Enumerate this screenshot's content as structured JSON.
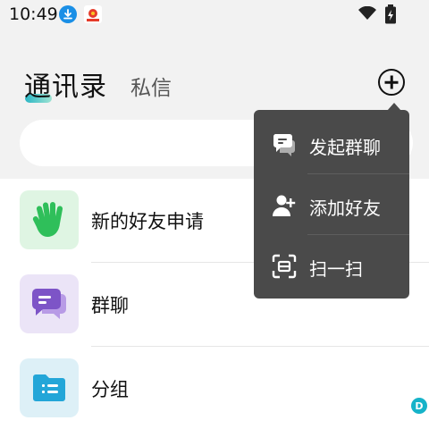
{
  "status_bar": {
    "time": "10:49",
    "icons": [
      "download-icon",
      "app-notification-icon",
      "wifi-icon",
      "battery-charging-icon"
    ]
  },
  "header": {
    "tabs": [
      {
        "label": "通讯录",
        "active": true
      },
      {
        "label": "私信",
        "active": false
      }
    ],
    "add_icon": "add-circle-icon"
  },
  "search": {
    "placeholder": ""
  },
  "contacts": {
    "items": [
      {
        "label": "新的好友申请",
        "icon": "waving-hand-icon",
        "tile_color": "#dff5e3",
        "icon_color": "#2fbf5a"
      },
      {
        "label": "群聊",
        "icon": "chat-bubbles-icon",
        "tile_color": "#ebe4f7",
        "icon_color": "#7d54c7"
      },
      {
        "label": "分组",
        "icon": "folder-icon",
        "tile_color": "#ddf0f7",
        "icon_color": "#23a6d8"
      }
    ]
  },
  "menu": {
    "items": [
      {
        "label": "发起群聊",
        "icon": "group-chat-icon"
      },
      {
        "label": "添加好友",
        "icon": "add-friend-icon"
      },
      {
        "label": "扫一扫",
        "icon": "scan-icon"
      }
    ]
  },
  "debug_badge": "D",
  "colors": {
    "accent": "#2bb6c4",
    "menu_bg": "#4a4a4a",
    "page_bg": "#f2f2f2"
  }
}
